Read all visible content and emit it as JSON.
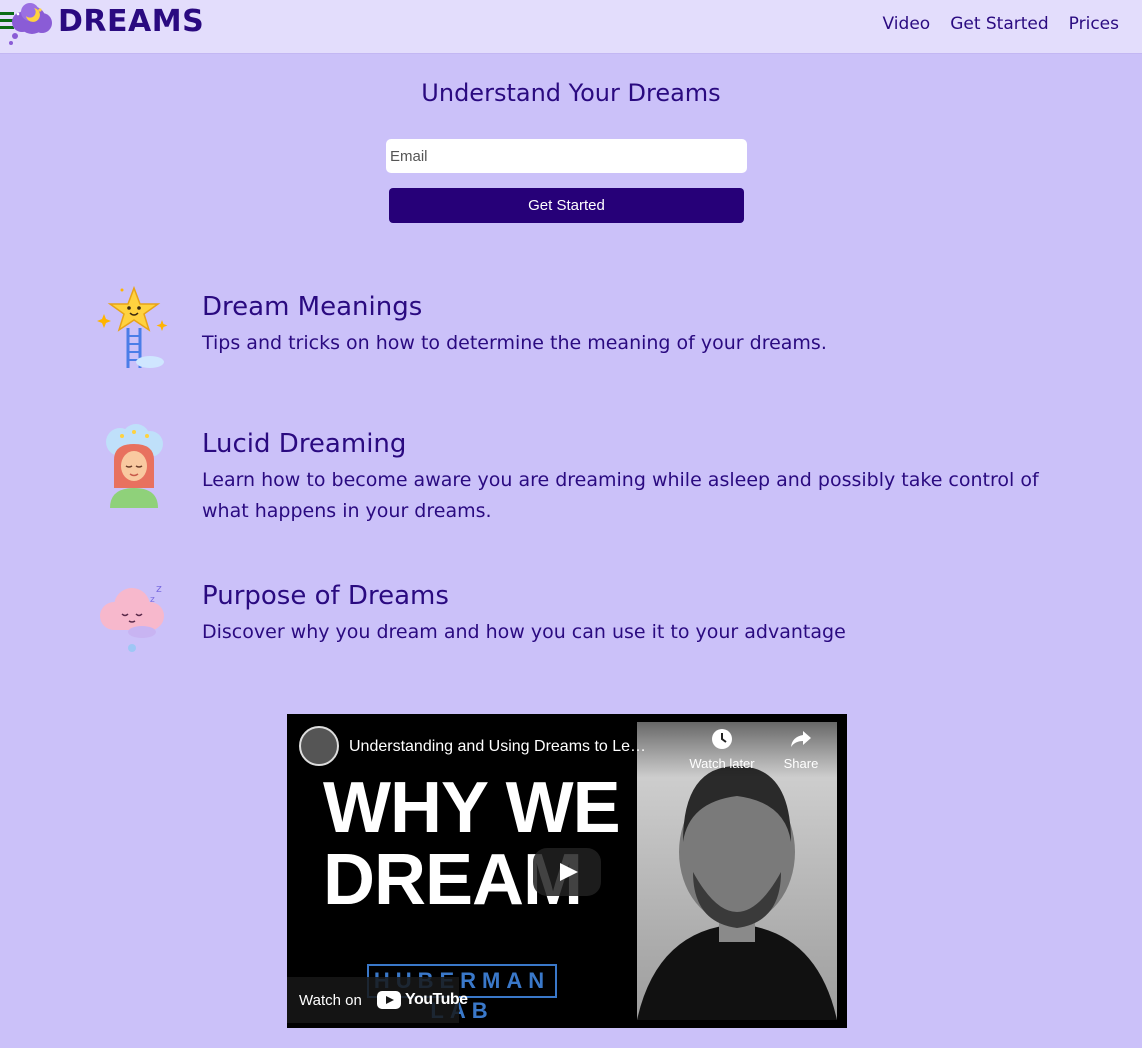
{
  "header": {
    "brand": "DREAMS",
    "nav": [
      "Video",
      "Get Started",
      "Prices"
    ]
  },
  "hero": {
    "title": "Understand Your Dreams",
    "email_placeholder": "Email",
    "cta_label": "Get Started"
  },
  "features": [
    {
      "title": "Dream Meanings",
      "description": "Tips and tricks on how to determine the meaning of your dreams.",
      "icon": "star-ladder-icon"
    },
    {
      "title": "Lucid Dreaming",
      "description": "Learn how to become aware you are dreaming while asleep and possibly take control of what happens in your dreams.",
      "icon": "dreaming-woman-icon"
    },
    {
      "title": "Purpose of Dreams",
      "description": "Discover why you dream and how you can use it to your advantage",
      "icon": "sleeping-cloud-icon"
    }
  ],
  "video": {
    "title": "Understanding and Using Dreams to Le…",
    "thumbnail_text": "WHY WE DREAM",
    "thumbnail_brand": "HUBERMAN LAB",
    "watch_later": "Watch later",
    "share": "Share",
    "watch_on": "Watch on",
    "youtube": "YouTube"
  },
  "colors": {
    "page_bg": "#cbc1f9",
    "header_bg": "#e3ddfc",
    "primary": "#260078",
    "text": "#2a0a80"
  }
}
